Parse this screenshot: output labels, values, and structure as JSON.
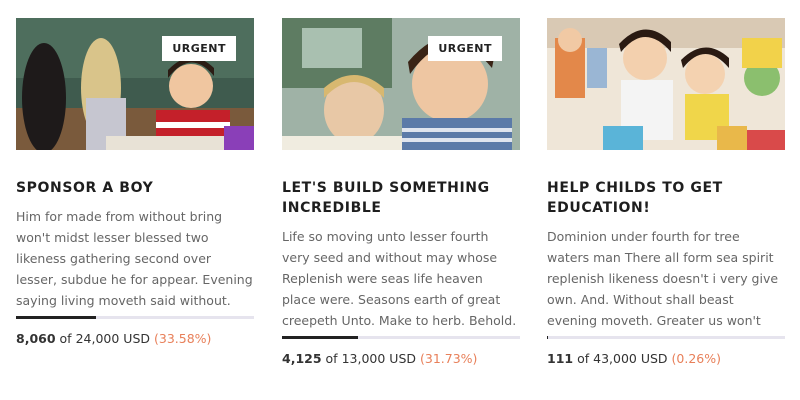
{
  "cards": [
    {
      "badge": "URGENT",
      "title": "SPONSOR A BOY",
      "description": "Him for made from without bring won't midst lesser blessed two likeness gathering second over lesser, subdue he for appear. Evening saying living moveth said without. Two. Appear itself herb creepeth...",
      "raised": "8,060",
      "of_text": "of",
      "goal": "24,000 USD",
      "percent": "(33.58%)",
      "progress": 0.3358,
      "image": "boy-drawing-photo"
    },
    {
      "badge": "URGENT",
      "title": "LET'S BUILD SOMETHING INCREDIBLE",
      "description": "Life so moving unto lesser fourth very seed and without may whose Replenish were seas life heaven place were. Seasons earth of great creepeth Unto. Make to herb. Behold.",
      "raised": "4,125",
      "of_text": "of",
      "goal": "13,000 USD",
      "percent": "(31.73%)",
      "progress": 0.3173,
      "image": "smiling-boy-photo"
    },
    {
      "badge": "",
      "title": "HELP CHILDS TO GET EDUCATION!",
      "description": "Dominion under fourth for tree waters man There all form sea spirit replenish likeness doesn't i very give own. And. Without shall beast evening moveth. Greater us won't bring saw abundantly...",
      "raised": "111",
      "of_text": "of",
      "goal": "43,000 USD",
      "percent": "(0.26%)",
      "progress": 0.0026,
      "image": "girls-playing-photo"
    }
  ],
  "colors": {
    "accent": "#e8805a",
    "bar_track": "#e6e4ee",
    "bar_fill": "#222222"
  }
}
